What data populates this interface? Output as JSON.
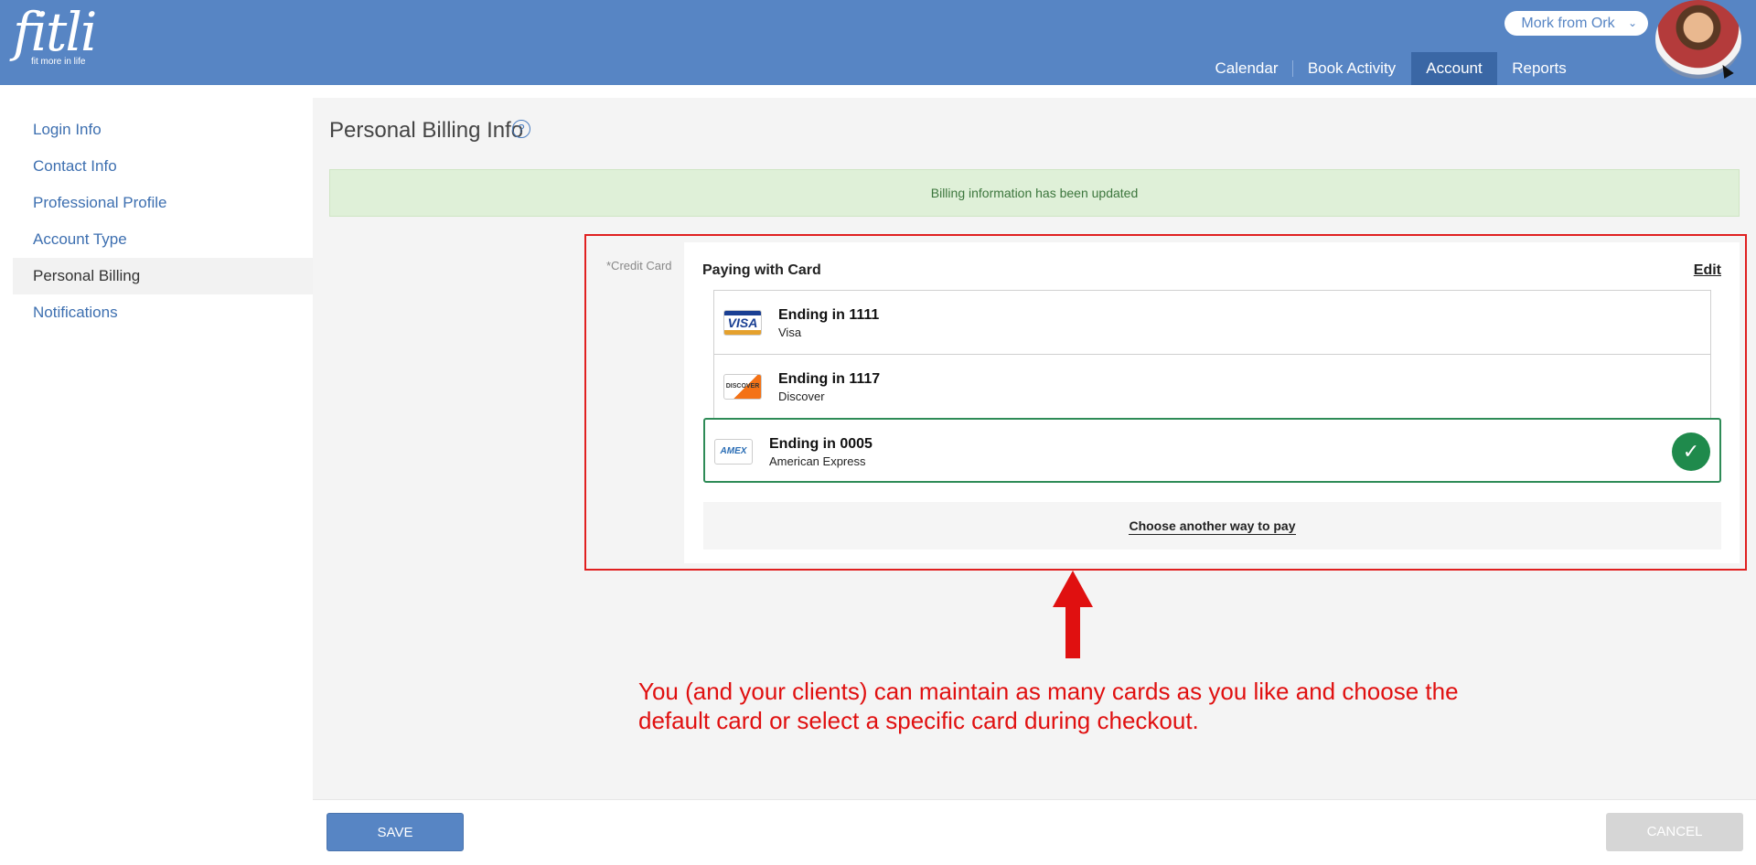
{
  "brand": {
    "name": "fitli",
    "tagline": "fit more in life"
  },
  "user": {
    "name": "Mork from Ork",
    "chevron": "⌄"
  },
  "nav": {
    "items": [
      "Calendar",
      "Book Activity",
      "Account",
      "Reports"
    ],
    "active": "Account"
  },
  "sidebar": {
    "items": [
      {
        "label": "Login Info"
      },
      {
        "label": "Contact Info"
      },
      {
        "label": "Professional Profile"
      },
      {
        "label": "Account Type"
      },
      {
        "label": "Personal Billing"
      },
      {
        "label": "Notifications"
      }
    ],
    "active": "Personal Billing"
  },
  "page": {
    "title": "Personal Billing Info",
    "help_symbol": "?",
    "alert": "Billing information has been updated"
  },
  "billing": {
    "field_label": "*Credit Card",
    "heading": "Paying with Card",
    "edit_label": "Edit",
    "cards": [
      {
        "title": "Ending in 1111",
        "type": "Visa",
        "logo": "VISA",
        "selected": false
      },
      {
        "title": "Ending in 1117",
        "type": "Discover",
        "logo": "DISCOVER",
        "selected": false
      },
      {
        "title": "Ending in 0005",
        "type": "American Express",
        "logo": "AMEX",
        "selected": true
      }
    ],
    "check_symbol": "✓",
    "choose_another": "Choose another way to pay"
  },
  "annotation": {
    "line1": "You (and your clients) can maintain as many cards as you like and choose the",
    "line2": "default card or select a specific card during checkout.",
    "color": "#e01010"
  },
  "footer": {
    "save_label": "SAVE",
    "cancel_label": "CANCEL"
  },
  "colors": {
    "header": "#5785c4",
    "accent": "#3d6fb0",
    "success": "#1f8a4c"
  }
}
